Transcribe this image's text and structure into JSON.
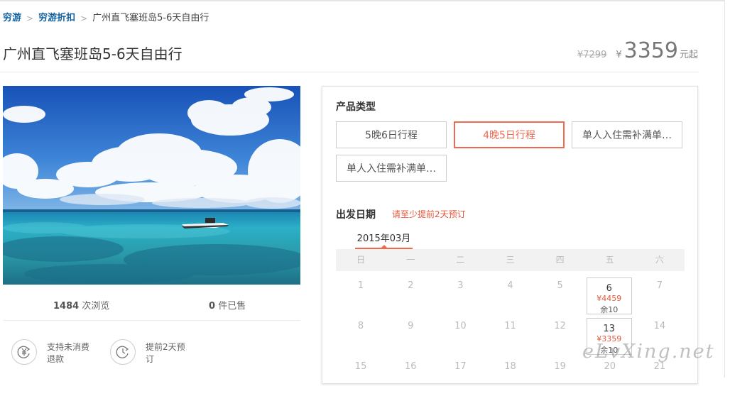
{
  "breadcrumb": {
    "items": [
      "穷游",
      "穷游折扣"
    ],
    "current": "广州直飞塞班岛5-6天自由行"
  },
  "product": {
    "title": "广州直飞塞班岛5-6天自由行",
    "original_price": "¥7299",
    "currency": "¥",
    "price": "3359",
    "price_suffix": "元起"
  },
  "stats": {
    "views_count": "1484",
    "views_label": "次浏览",
    "sold_count": "0",
    "sold_label": "件已售"
  },
  "features": [
    {
      "icon": "yen-refund-icon",
      "label": "支持未消费退款"
    },
    {
      "icon": "clock-icon",
      "label": "提前2天预订"
    }
  ],
  "booking": {
    "product_type_label": "产品类型",
    "options": [
      {
        "label": "5晚6日行程",
        "selected": false
      },
      {
        "label": "4晚5日行程",
        "selected": true
      },
      {
        "label": "单人入住需补满单…",
        "selected": false
      },
      {
        "label": "单人入住需补满单…",
        "selected": false
      }
    ],
    "date_label": "出发日期",
    "date_tip": "请至少提前2天预订",
    "month_tab": "2015年03月",
    "weekdays": [
      "日",
      "一",
      "二",
      "三",
      "四",
      "五",
      "六"
    ],
    "weeks": [
      [
        {
          "day": "1"
        },
        {
          "day": "2"
        },
        {
          "day": "3"
        },
        {
          "day": "4"
        },
        {
          "day": "5"
        },
        {
          "day": "6",
          "price": "¥4459",
          "remain": "余10"
        },
        {
          "day": "7"
        }
      ],
      [
        {
          "day": "8"
        },
        {
          "day": "9"
        },
        {
          "day": "10"
        },
        {
          "day": "11"
        },
        {
          "day": "12"
        },
        {
          "day": "13",
          "price": "¥3359",
          "remain": "余10"
        },
        {
          "day": "14"
        }
      ],
      [
        {
          "day": "15"
        },
        {
          "day": "16"
        },
        {
          "day": "17"
        },
        {
          "day": "18"
        },
        {
          "day": "19"
        },
        {
          "day": "20"
        },
        {
          "day": "21"
        }
      ]
    ]
  },
  "colors": {
    "accent": "#ed6a4f",
    "link": "#0f5e9e"
  },
  "watermark": "eLvXing.net"
}
